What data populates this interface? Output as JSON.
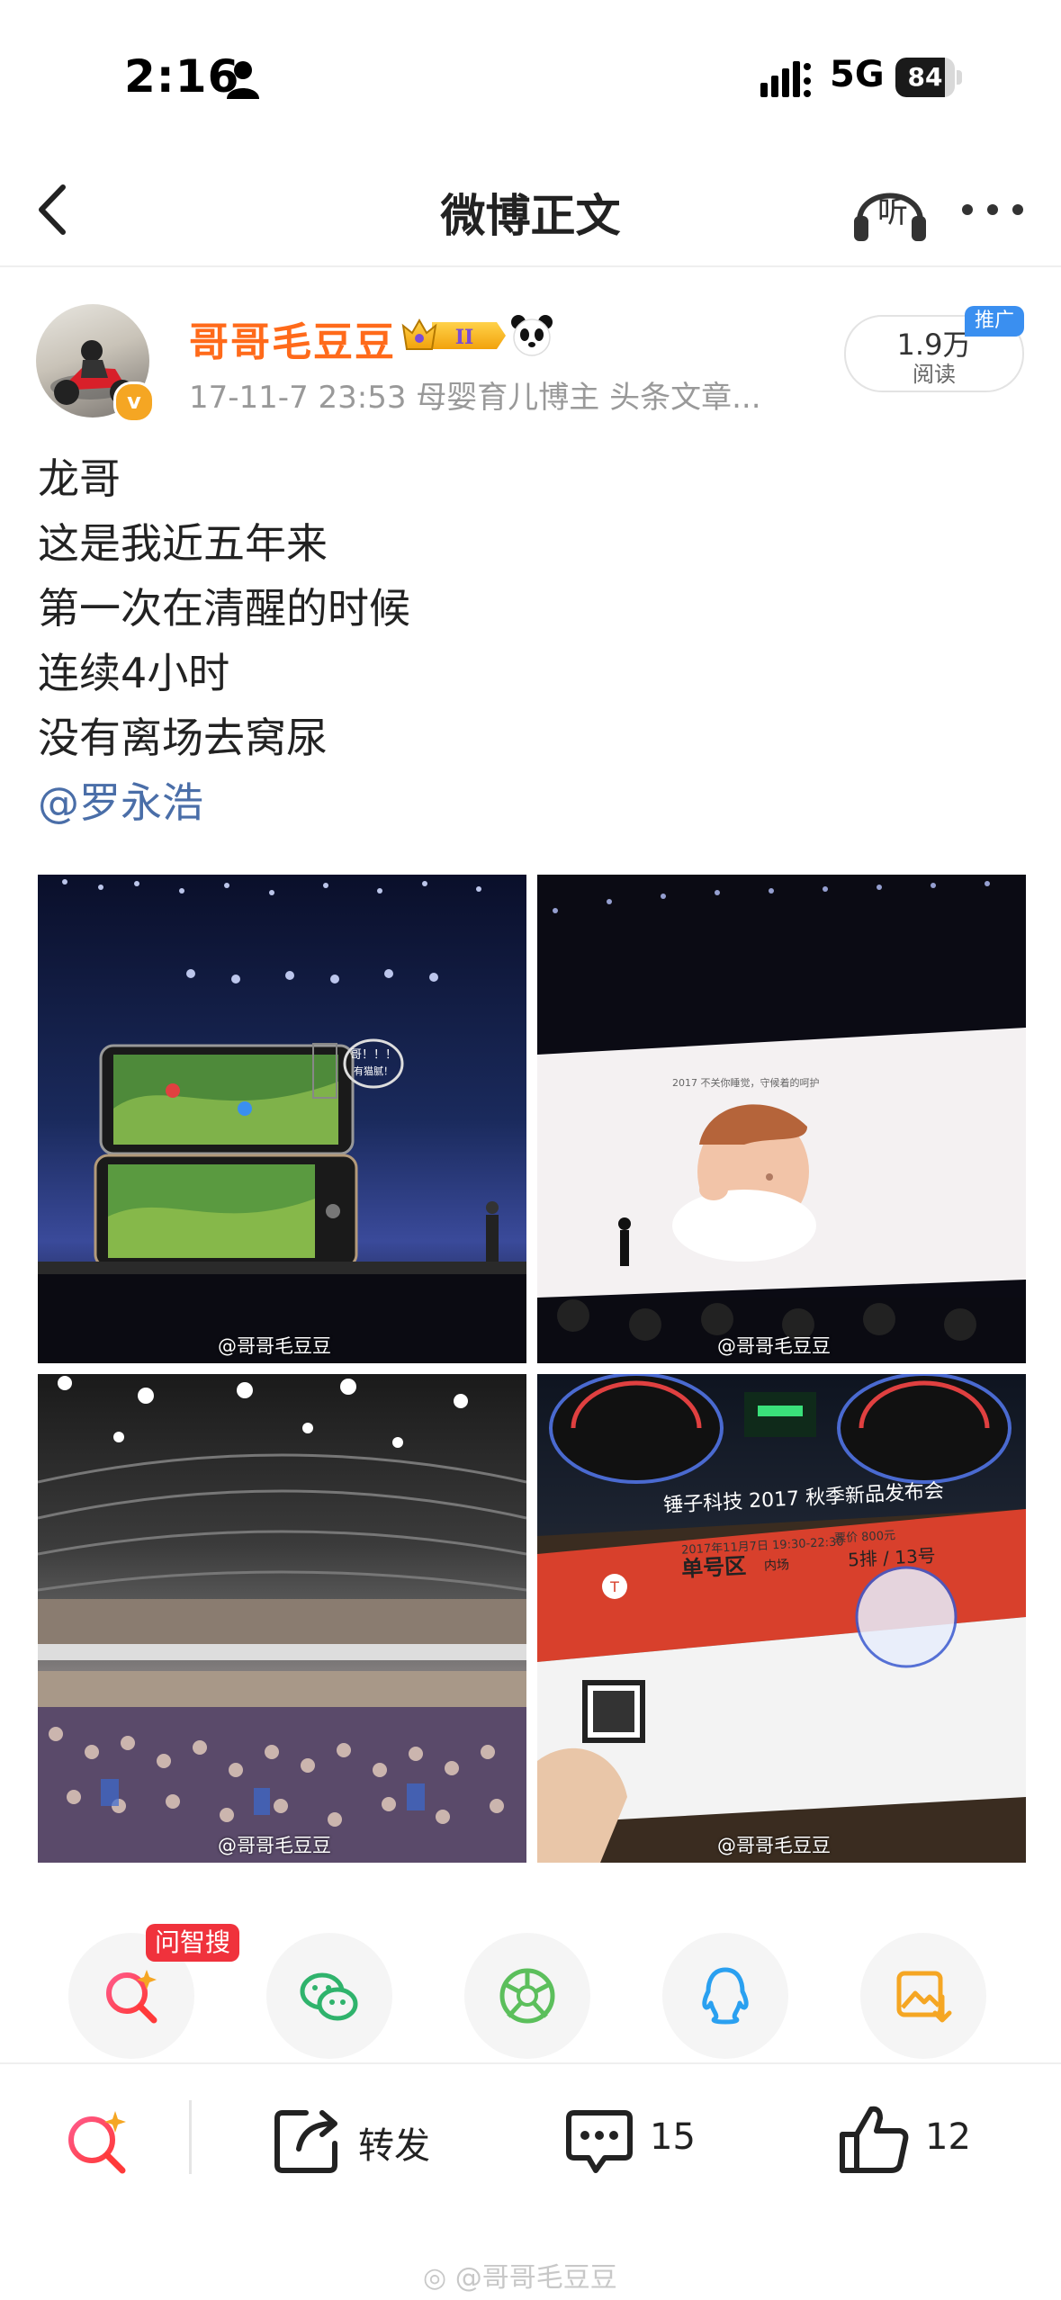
{
  "status_bar": {
    "time": "2:16",
    "network": "5G",
    "battery": "84",
    "battery_level": 0.84
  },
  "nav": {
    "title": "微博正文",
    "listen_label": "听"
  },
  "post": {
    "user_name": "哥哥毛豆豆",
    "vip_level": "II",
    "verified_mark": "v",
    "meta": "17-11-7 23:53  母婴育儿博主 头条文章...",
    "read_count": "1.9万",
    "read_label": "阅读",
    "promo_tag": "推广",
    "text_lines": [
      "龙哥",
      "这是我近五年来",
      "第一次在清醒的时候",
      "连续4小时",
      "没有离场去窝尿"
    ],
    "mention": "@罗永浩",
    "image_watermark": "@哥哥毛豆豆",
    "images": [
      {
        "name": "phones-on-stage",
        "bubble": "哥！！！有猫腻！"
      },
      {
        "name": "baby-on-screen",
        "caption": "2017 不关你睡觉，守候着的呵护"
      },
      {
        "name": "arena-crowd"
      },
      {
        "name": "event-ticket",
        "ticket_title": "锤子科技 2017 秋季新品发布会",
        "zone": "单号区",
        "zone_suffix": "内场",
        "seat": "5排  /  13号",
        "datetime": "2017年11月7日 19:30-22:30",
        "price": "票价 800元"
      }
    ]
  },
  "share": {
    "ask_tag": "问智搜",
    "items": [
      "zhisou-search",
      "wechat",
      "moments",
      "qq",
      "save-image"
    ]
  },
  "actions": {
    "repost_label": "转发",
    "comment_count": "15",
    "like_count": "12"
  },
  "footer": {
    "watermark": "@哥哥毛豆豆"
  },
  "colors": {
    "username": "#ff6a1a",
    "mention": "#4a6ea8",
    "ask_tag": "#f0323c",
    "promo": "#3a8ff0"
  }
}
